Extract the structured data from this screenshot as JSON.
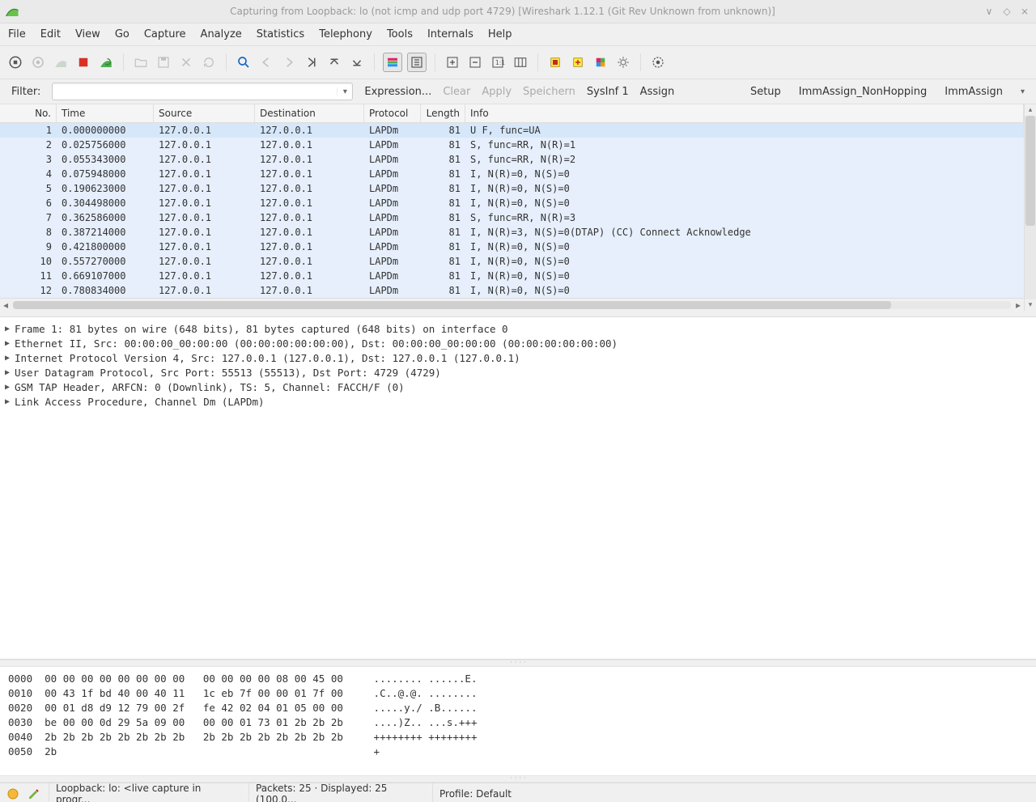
{
  "title": "Capturing from Loopback: lo (not icmp and udp port 4729)    [Wireshark 1.12.1  (Git Rev Unknown from unknown)]",
  "menu": [
    "File",
    "Edit",
    "View",
    "Go",
    "Capture",
    "Analyze",
    "Statistics",
    "Telephony",
    "Tools",
    "Internals",
    "Help"
  ],
  "filterbar": {
    "label": "Filter:",
    "value": "",
    "expression": "Expression...",
    "clear": "Clear",
    "apply": "Apply",
    "save": "Speichern",
    "sysinf": "SysInf 1",
    "assign": "Assign",
    "setup": "Setup",
    "imm_nonhop": "ImmAssign_NonHopping",
    "imm": "ImmAssign"
  },
  "columns": {
    "no": "No.",
    "time": "Time",
    "src": "Source",
    "dst": "Destination",
    "prot": "Protocol",
    "len": "Length",
    "info": "Info"
  },
  "packets": [
    {
      "no": 1,
      "time": "0.000000000",
      "src": "127.0.0.1",
      "dst": "127.0.0.1",
      "prot": "LAPDm",
      "len": 81,
      "info": "U F, func=UA"
    },
    {
      "no": 2,
      "time": "0.025756000",
      "src": "127.0.0.1",
      "dst": "127.0.0.1",
      "prot": "LAPDm",
      "len": 81,
      "info": "S, func=RR, N(R)=1"
    },
    {
      "no": 3,
      "time": "0.055343000",
      "src": "127.0.0.1",
      "dst": "127.0.0.1",
      "prot": "LAPDm",
      "len": 81,
      "info": "S, func=RR, N(R)=2"
    },
    {
      "no": 4,
      "time": "0.075948000",
      "src": "127.0.0.1",
      "dst": "127.0.0.1",
      "prot": "LAPDm",
      "len": 81,
      "info": "I, N(R)=0, N(S)=0"
    },
    {
      "no": 5,
      "time": "0.190623000",
      "src": "127.0.0.1",
      "dst": "127.0.0.1",
      "prot": "LAPDm",
      "len": 81,
      "info": "I, N(R)=0, N(S)=0"
    },
    {
      "no": 6,
      "time": "0.304498000",
      "src": "127.0.0.1",
      "dst": "127.0.0.1",
      "prot": "LAPDm",
      "len": 81,
      "info": "I, N(R)=0, N(S)=0"
    },
    {
      "no": 7,
      "time": "0.362586000",
      "src": "127.0.0.1",
      "dst": "127.0.0.1",
      "prot": "LAPDm",
      "len": 81,
      "info": "S, func=RR, N(R)=3"
    },
    {
      "no": 8,
      "time": "0.387214000",
      "src": "127.0.0.1",
      "dst": "127.0.0.1",
      "prot": "LAPDm",
      "len": 81,
      "info": "I, N(R)=3, N(S)=0(DTAP) (CC) Connect Acknowledge"
    },
    {
      "no": 9,
      "time": "0.421800000",
      "src": "127.0.0.1",
      "dst": "127.0.0.1",
      "prot": "LAPDm",
      "len": 81,
      "info": "I, N(R)=0, N(S)=0"
    },
    {
      "no": 10,
      "time": "0.557270000",
      "src": "127.0.0.1",
      "dst": "127.0.0.1",
      "prot": "LAPDm",
      "len": 81,
      "info": "I, N(R)=0, N(S)=0"
    },
    {
      "no": 11,
      "time": "0.669107000",
      "src": "127.0.0.1",
      "dst": "127.0.0.1",
      "prot": "LAPDm",
      "len": 81,
      "info": "I, N(R)=0, N(S)=0"
    },
    {
      "no": 12,
      "time": "0.780834000",
      "src": "127.0.0.1",
      "dst": "127.0.0.1",
      "prot": "LAPDm",
      "len": 81,
      "info": "I, N(R)=0, N(S)=0"
    }
  ],
  "details": [
    "Frame 1: 81 bytes on wire (648 bits), 81 bytes captured (648 bits) on interface 0",
    "Ethernet II, Src: 00:00:00_00:00:00 (00:00:00:00:00:00), Dst: 00:00:00_00:00:00 (00:00:00:00:00:00)",
    "Internet Protocol Version 4, Src: 127.0.0.1 (127.0.0.1), Dst: 127.0.0.1 (127.0.0.1)",
    "User Datagram Protocol, Src Port: 55513 (55513), Dst Port: 4729 (4729)",
    "GSM TAP Header, ARFCN: 0 (Downlink), TS: 5, Channel: FACCH/F (0)",
    "Link Access Procedure, Channel Dm (LAPDm)"
  ],
  "hex": [
    {
      "off": "0000",
      "b1": "00 00 00 00 00 00 00 00",
      "b2": "00 00 00 00 08 00 45 00",
      "a": "........ ......E."
    },
    {
      "off": "0010",
      "b1": "00 43 1f bd 40 00 40 11",
      "b2": "1c eb 7f 00 00 01 7f 00",
      "a": ".C..@.@. ........"
    },
    {
      "off": "0020",
      "b1": "00 01 d8 d9 12 79 00 2f",
      "b2": "fe 42 02 04 01 05 00 00",
      "a": ".....y./ .B......"
    },
    {
      "off": "0030",
      "b1": "be 00 00 0d 29 5a 09 00",
      "b2": "00 00 01 73 01 2b 2b 2b",
      "a": "....)Z.. ...s.+++"
    },
    {
      "off": "0040",
      "b1": "2b 2b 2b 2b 2b 2b 2b 2b",
      "b2": "2b 2b 2b 2b 2b 2b 2b 2b",
      "a": "++++++++ ++++++++"
    },
    {
      "off": "0050",
      "b1": "2b",
      "b2": "",
      "a": "+"
    }
  ],
  "status": {
    "iface": "Loopback: lo: <live capture in progr...",
    "packets": "Packets: 25 · Displayed: 25 (100,0...",
    "profile": "Profile: Default"
  }
}
